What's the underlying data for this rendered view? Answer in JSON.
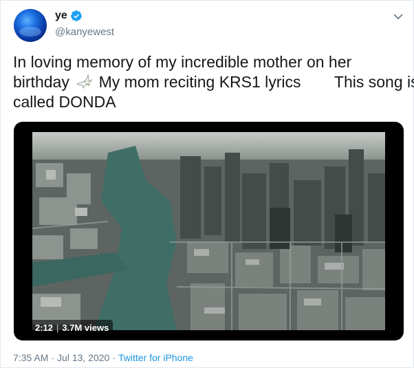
{
  "user": {
    "display_name": "ye",
    "handle": "@kanyewest",
    "verified": true
  },
  "tweet": {
    "text_line1": "In loving memory of my incredible mother on her",
    "text_line2_a": "birthday",
    "text_line2_b": "My mom reciting KRS1 lyrics",
    "text_line2_c": "This song is",
    "text_line3": "called DONDA"
  },
  "media": {
    "duration": "2:12",
    "separator": "|",
    "views": "3.7M views"
  },
  "meta": {
    "time": "7:35 AM",
    "dot": "·",
    "date": "Jul 13, 2020",
    "dot2": "·",
    "source": "Twitter for iPhone"
  },
  "colors": {
    "accent": "#1b95e0",
    "secondary_text": "#657786",
    "verified_badge": "#1da1f2"
  },
  "icons": {
    "verified": "verified-badge-icon",
    "caret": "chevron-down-icon",
    "emoji": "dove-icon"
  }
}
